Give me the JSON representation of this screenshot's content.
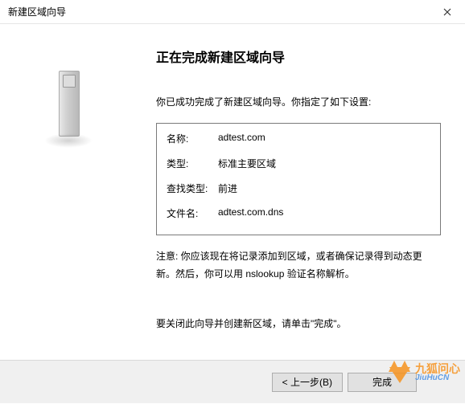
{
  "titlebar": {
    "title": "新建区域向导",
    "close_aria": "Close"
  },
  "content": {
    "heading": "正在完成新建区域向导",
    "intro": "你已成功完成了新建区域向导。你指定了如下设置:",
    "settings": {
      "name_label": "名称:",
      "name_value": "adtest.com",
      "type_label": "类型:",
      "type_value": "标准主要区域",
      "lookup_label": "查找类型:",
      "lookup_value": "前进",
      "file_label": "文件名:",
      "file_value": "adtest.com.dns"
    },
    "note": "注意: 你应该现在将记录添加到区域，或者确保记录得到动态更新。然后，你可以用 nslookup 验证名称解析。",
    "instruction": "要关闭此向导并创建新区域，请单击\"完成\"。"
  },
  "footer": {
    "back_label": "< 上一步(B)",
    "finish_label": "完成"
  },
  "watermark": {
    "cn": "九狐问心",
    "en": "JiuHuCN"
  }
}
